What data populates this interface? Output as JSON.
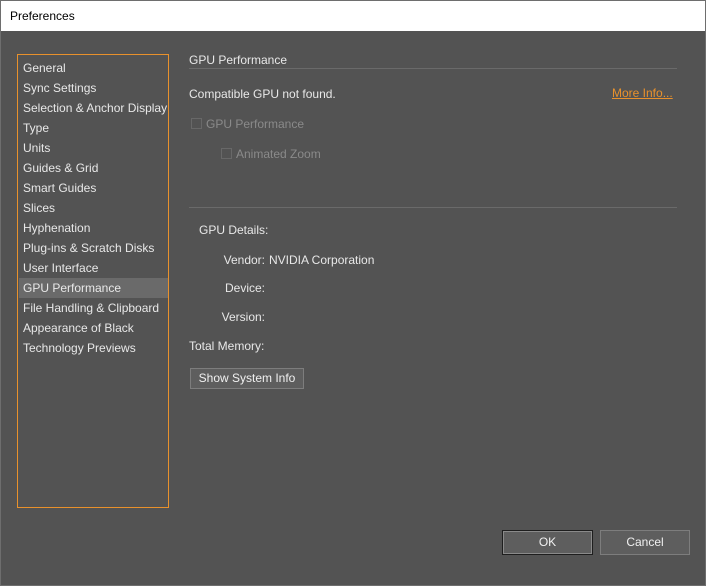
{
  "window": {
    "title": "Preferences"
  },
  "sidebar": {
    "items": [
      {
        "label": "General"
      },
      {
        "label": "Sync Settings"
      },
      {
        "label": "Selection & Anchor Display"
      },
      {
        "label": "Type"
      },
      {
        "label": "Units"
      },
      {
        "label": "Guides & Grid"
      },
      {
        "label": "Smart Guides"
      },
      {
        "label": "Slices"
      },
      {
        "label": "Hyphenation"
      },
      {
        "label": "Plug-ins & Scratch Disks"
      },
      {
        "label": "User Interface"
      },
      {
        "label": "GPU Performance"
      },
      {
        "label": "File Handling & Clipboard"
      },
      {
        "label": "Appearance of Black"
      },
      {
        "label": "Technology Previews"
      }
    ],
    "selected": "GPU Performance"
  },
  "main": {
    "section_title": "GPU Performance",
    "status_text": "Compatible GPU not found.",
    "more_info_link": "More Info...",
    "gpu_performance_checkbox": {
      "label": "GPU Performance",
      "checked": false,
      "enabled": false
    },
    "animated_zoom_checkbox": {
      "label": "Animated Zoom",
      "checked": false,
      "enabled": false
    },
    "gpu_details_label": "GPU Details:",
    "vendor_label": "Vendor:",
    "vendor_value": "NVIDIA Corporation",
    "device_label": "Device:",
    "device_value": "",
    "version_label": "Version:",
    "version_value": "",
    "total_memory_label": "Total Memory:",
    "total_memory_value": "",
    "show_system_info_button": "Show System Info"
  },
  "footer": {
    "ok_button": "OK",
    "cancel_button": "Cancel"
  },
  "colors": {
    "background": "#535353",
    "accent": "#e8912c",
    "text": "#e8e8e8",
    "disabled_text": "#8a8a8a"
  }
}
